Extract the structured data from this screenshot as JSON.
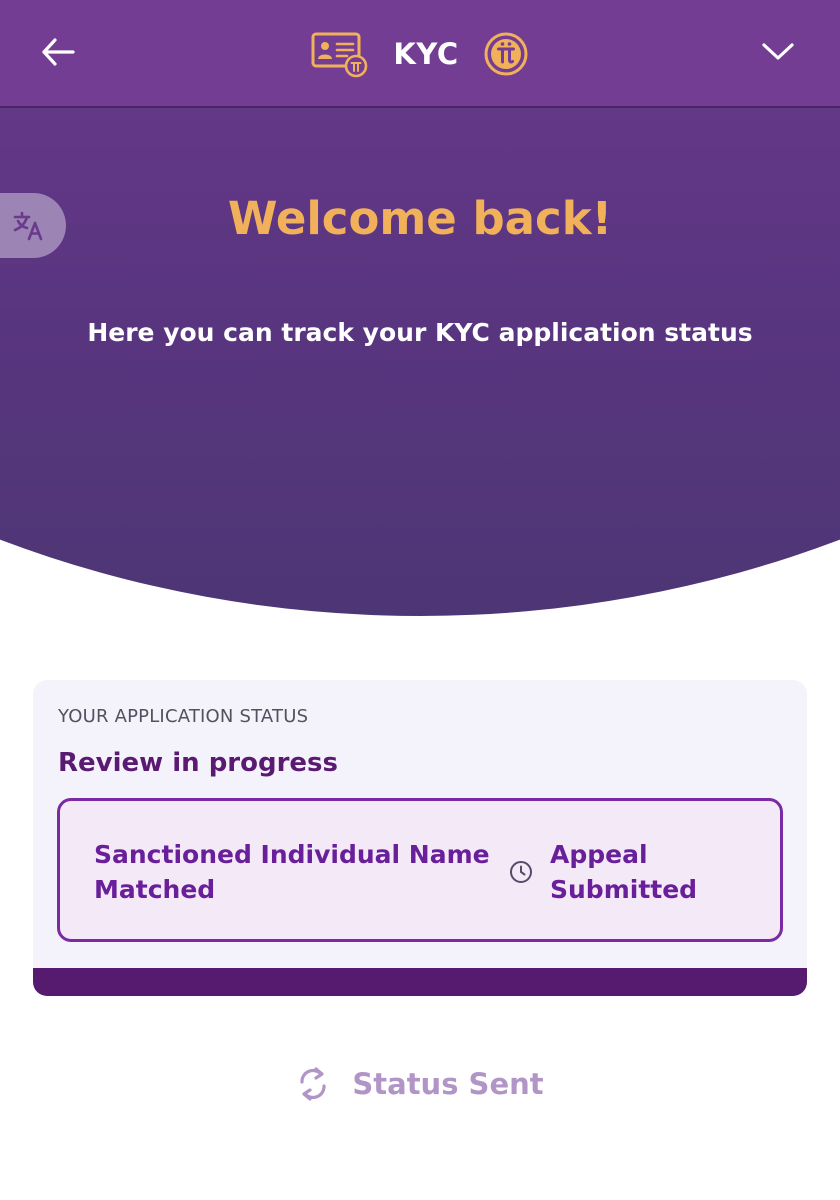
{
  "header": {
    "title": "KYC",
    "back_icon": "back-arrow-icon",
    "id_card_icon": "id-card-icon",
    "pi_logo_icon": "pi-logo-icon",
    "menu_icon": "chevron-down-icon"
  },
  "hero": {
    "welcome": "Welcome back!",
    "subtitle": "Here you can track your KYC application status",
    "translate_icon": "translate-icon"
  },
  "status_card": {
    "label": "YOUR APPLICATION STATUS",
    "status": "Review in progress",
    "reason": "Sanctioned Individual Name Matched",
    "appeal": "Appeal Submitted",
    "clock_icon": "clock-icon"
  },
  "footer": {
    "status_sent": "Status Sent",
    "refresh_icon": "refresh-icon"
  },
  "colors": {
    "header_bg": "#733d93",
    "hero_bg": "#6a3a8c",
    "accent_orange": "#f1b15a",
    "status_purple": "#6a1f9a",
    "card_footer": "#561a6e",
    "muted_purple": "#b295c7"
  }
}
